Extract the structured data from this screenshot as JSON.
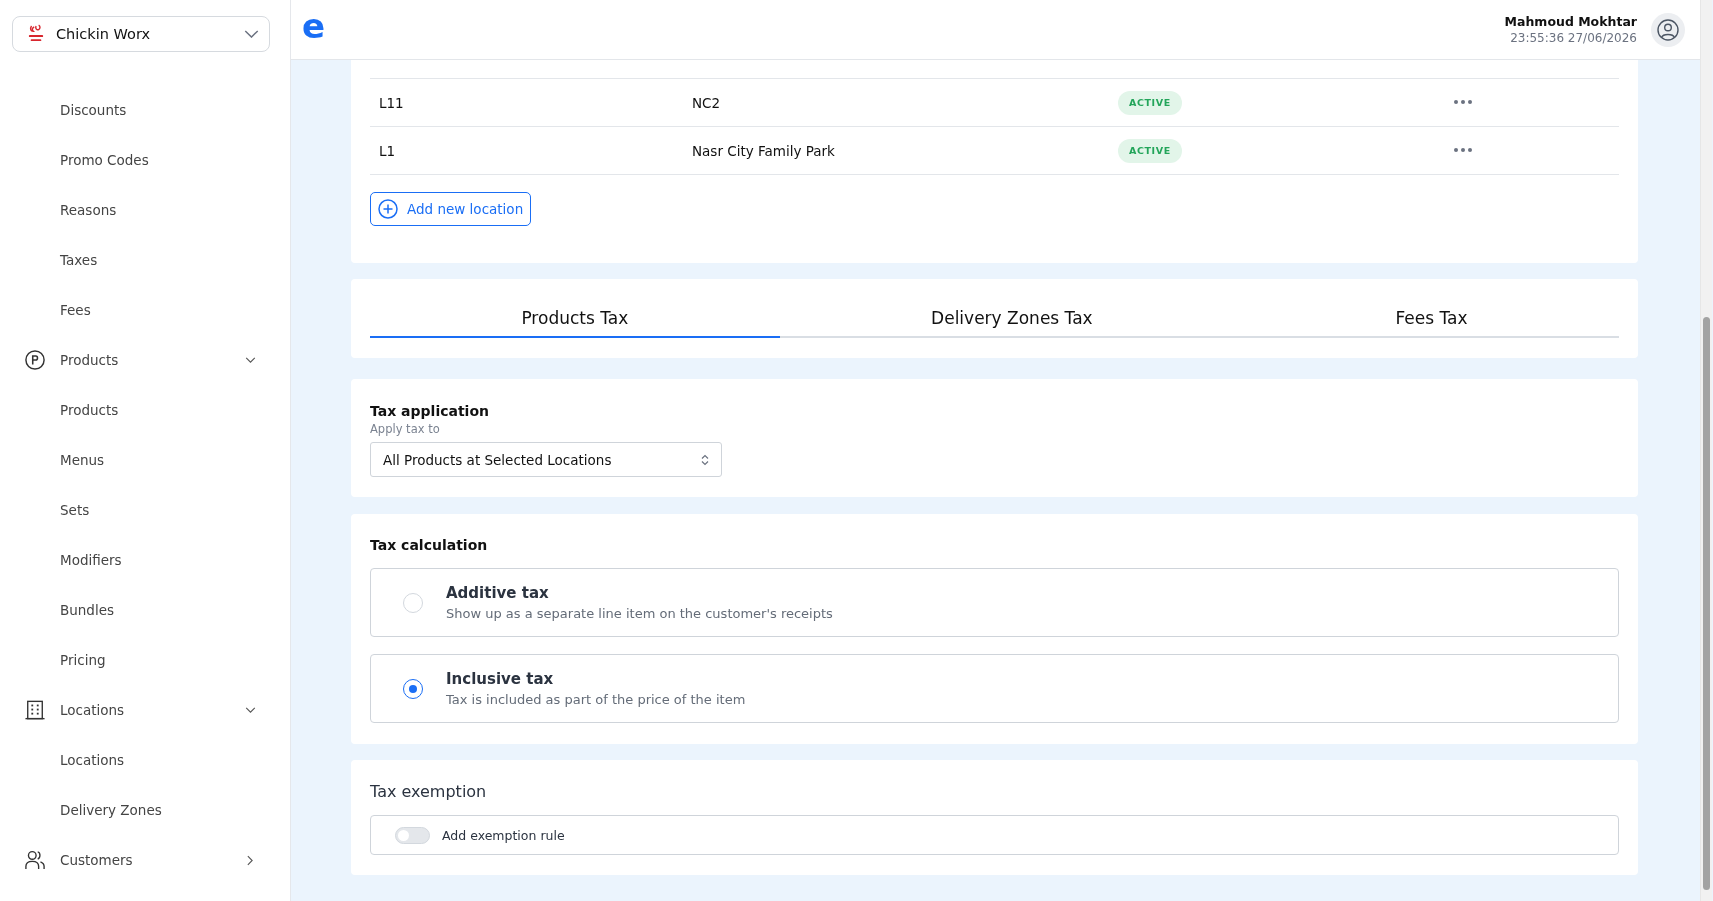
{
  "sidebar": {
    "account_switcher": {
      "name": "Chickin Worx"
    },
    "nav": [
      {
        "kind": "link",
        "label": "Discounts"
      },
      {
        "kind": "link",
        "label": "Promo Codes"
      },
      {
        "kind": "link",
        "label": "Reasons"
      },
      {
        "kind": "link",
        "label": "Taxes"
      },
      {
        "kind": "link",
        "label": "Fees"
      },
      {
        "kind": "group",
        "label": "Products",
        "expanded": true,
        "children": [
          {
            "label": "Products"
          },
          {
            "label": "Menus"
          },
          {
            "label": "Sets"
          },
          {
            "label": "Modifiers"
          },
          {
            "label": "Bundles"
          },
          {
            "label": "Pricing"
          }
        ]
      },
      {
        "kind": "group",
        "label": "Locations",
        "expanded": true,
        "children": [
          {
            "label": "Locations"
          },
          {
            "label": "Delivery Zones"
          }
        ]
      },
      {
        "kind": "group",
        "label": "Customers",
        "expanded": false
      }
    ]
  },
  "topbar": {
    "brand_mark": "e",
    "user": {
      "name": "Mahmoud Mokhtar",
      "timestamp": "23:55:36 27/06/2026"
    }
  },
  "locations_table": {
    "rows": [
      {
        "code": "L11",
        "name": "NC2",
        "status": "ACTIVE"
      },
      {
        "code": "L1",
        "name": "Nasr City Family Park",
        "status": "ACTIVE"
      }
    ],
    "add_button": "Add new location"
  },
  "tax_tabs": [
    {
      "label": "Products Tax",
      "selected": true
    },
    {
      "label": "Delivery Zones Tax",
      "selected": false
    },
    {
      "label": "Fees Tax",
      "selected": false
    }
  ],
  "tax_application": {
    "title": "Tax application",
    "label": "Apply tax to",
    "value": "All Products at Selected Locations"
  },
  "tax_calculation": {
    "title": "Tax calculation",
    "options": [
      {
        "title": "Additive tax",
        "description": "Show up as a separate line item on the customer's receipts",
        "selected": false
      },
      {
        "title": "Inclusive tax",
        "description": "Tax is included as part of the price of the item",
        "selected": true
      }
    ]
  },
  "tax_exemption": {
    "title": "Tax exemption",
    "toggle": {
      "label": "Add exemption rule",
      "on": false
    }
  }
}
